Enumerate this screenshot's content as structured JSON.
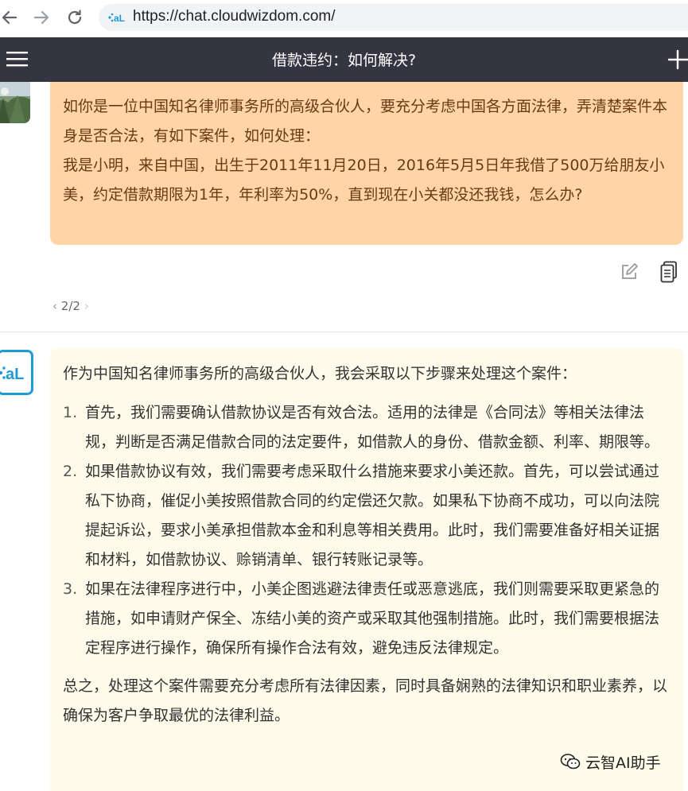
{
  "browser": {
    "url": "https://chat.cloudwizdom.com/",
    "back_icon": "arrow-left-icon",
    "forward_icon": "arrow-right-icon",
    "reload_icon": "reload-icon"
  },
  "header": {
    "title": "借款违约：如何解决?",
    "menu_icon": "hamburger-menu-icon",
    "new_chat_icon": "plus-icon",
    "background": "#343541"
  },
  "user_message": {
    "lines": [
      "如你是一位中国知名律师事务所的高级合伙人，要充分考虑中国各方面法律，弄清楚案件本身是否合法，有如下案件，如何处理：",
      "我是小明，来自中国，出生于2011年11月20日，2016年5月5日年我借了500万给朋友小美，约定借款期限为1年，年利率为50%，直到现在小关都没还我钱，怎么办?"
    ],
    "bubble_color": "#fdd5a7",
    "actions": {
      "edit_icon": "edit-icon",
      "copy_icon": "copy-icon"
    },
    "pager": {
      "prev": "‹",
      "label": "2/2",
      "next": "›"
    }
  },
  "assistant_message": {
    "intro": "作为中国知名律师事务所的高级合伙人，我会采取以下步骤来处理这个案件：",
    "steps": [
      {
        "num": "1.",
        "text": "首先，我们需要确认借款协议是否有效合法。适用的法律是《合同法》等相关法律法规，判断是否满足借款合同的法定要件，如借款人的身份、借款金额、利率、期限等。"
      },
      {
        "num": "2.",
        "text": "如果借款协议有效，我们需要考虑采取什么措施来要求小美还款。首先，可以尝试通过私下协商，催促小美按照借款合同的约定偿还欠款。如果私下协商不成功，可以向法院提起诉讼，要求小美承担借款本金和利息等相关费用。此时，我们需要准备好相关证据和材料，如借款协议、赊销清单、银行转账记录等。"
      },
      {
        "num": "3.",
        "text": "如果在法律程序进行中，小美企图逃避法律责任或恶意逃底，我们则需要采取更紧急的措施，如申请财产保全、冻结小美的资产或采取其他强制措施。此时，我们需要根据法定程序进行操作，确保所有操作合法有效，避免违反法律规定。"
      }
    ],
    "conclusion": "总之，处理这个案件需要充分考虑所有法律因素，同时具备娴熟的法律知识和职业素养，以确保为客户争取最优的法律利益。",
    "bubble_color": "#fffbeb",
    "avatar_text": "aiL",
    "avatar_color": "#1e9bd7"
  },
  "watermark": {
    "icon": "wechat-icon",
    "text": "云智AI助手"
  }
}
